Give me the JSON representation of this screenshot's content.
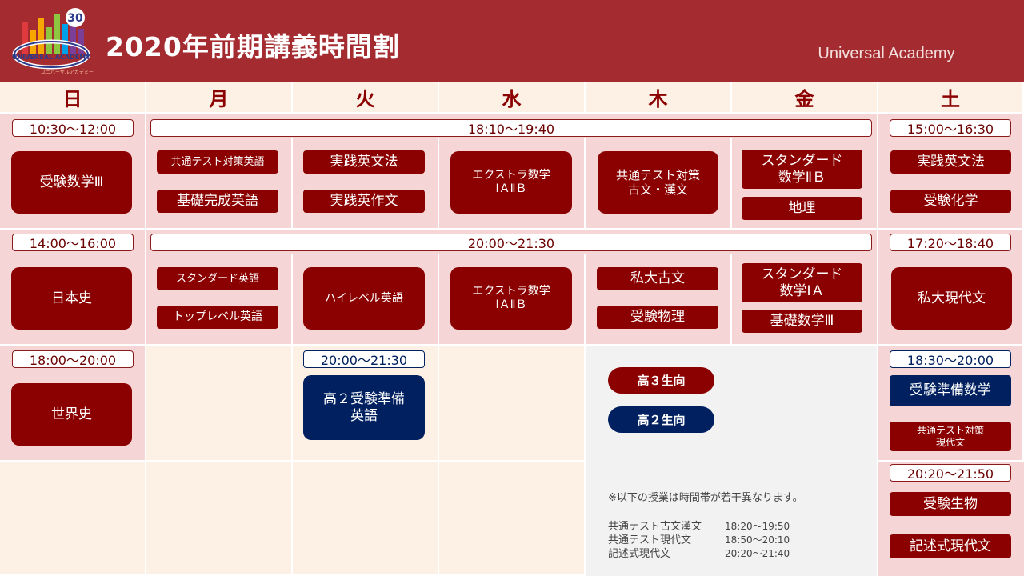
{
  "header": {
    "title": "2020年前期講義時間割",
    "brand": "Universal Academy",
    "logo": {
      "badge_number": "30",
      "ring_text": "UNIVERSAL ACADEMY",
      "sub_text": "ユニバーサルアカデミー",
      "colors": [
        "#e03a3e",
        "#f7a800",
        "#8dc63f",
        "#00a0e9",
        "#7b3f98"
      ]
    }
  },
  "days": [
    "日",
    "月",
    "火",
    "水",
    "木",
    "金",
    "土"
  ],
  "rows": {
    "row1": {
      "sun_time": "10:30〜12:00",
      "weekday_time": "18:10〜19:40",
      "sat_time": "15:00〜16:30",
      "sun": [
        "受験数学Ⅲ"
      ],
      "mon": [
        "共通テスト対策英語",
        "基礎完成英語"
      ],
      "tue": [
        "実践英文法",
        "実践英作文"
      ],
      "wed": [
        "エクストラ数学\nⅠＡⅡＢ"
      ],
      "thu": [
        "共通テスト対策\n古文・漢文"
      ],
      "fri": [
        "スタンダード\n数学ⅡＢ",
        "地理"
      ],
      "sat": [
        "実践英文法",
        "受験化学"
      ]
    },
    "row2": {
      "sun_time": "14:00〜16:00",
      "weekday_time": "20:00〜21:30",
      "sat_time": "17:20〜18:40",
      "sun": [
        "日本史"
      ],
      "mon": [
        "スタンダード英語",
        "トップレベル英語"
      ],
      "tue": [
        "ハイレベル英語"
      ],
      "wed": [
        "エクストラ数学\nⅠＡⅡＢ"
      ],
      "thu": [
        "私大古文",
        "受験物理"
      ],
      "fri": [
        "スタンダード\n数学ⅠＡ",
        "基礎数学Ⅲ"
      ],
      "sat": [
        "私大現代文"
      ]
    },
    "row3": {
      "sun_time": "18:00〜20:00",
      "tue_time": "20:00〜21:30",
      "sat_time": "18:30〜20:00",
      "sun": [
        "世界史"
      ],
      "tue": [
        "高２受験準備\n英語"
      ],
      "sat": [
        "受験準備数学",
        "共通テスト対策\n現代文"
      ]
    },
    "row4": {
      "sat_time": "20:20〜21:50",
      "sat": [
        "受験生物",
        "記述式現代文"
      ]
    }
  },
  "legend": {
    "grade3": "高３生向",
    "grade2": "高２生向",
    "grade3_color": "#8b0000",
    "grade2_color": "#002060"
  },
  "notes": {
    "intro": "※以下の授業は時間帯が若干異なります。",
    "items": [
      {
        "name": "共通テスト古文漢文",
        "time": "18:20〜19:50"
      },
      {
        "name": "共通テスト現代文",
        "time": "18:50〜20:10"
      },
      {
        "name": "記述式現代文",
        "time": "20:20〜21:40"
      }
    ]
  }
}
